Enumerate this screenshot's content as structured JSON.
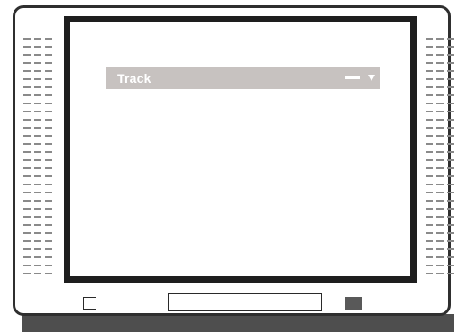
{
  "osd": {
    "label": "Track",
    "text_color": "#ffffff",
    "bar_color": "#c7c2c0"
  },
  "tv": {
    "frame_color": "#2f2f2f",
    "screen_border_color": "#1e1e1e",
    "shadow_color": "#4e4e4e",
    "right_button_color": "#595959"
  },
  "icons": {
    "minus": "minus-icon",
    "dropdown": "triangle-down-icon"
  }
}
